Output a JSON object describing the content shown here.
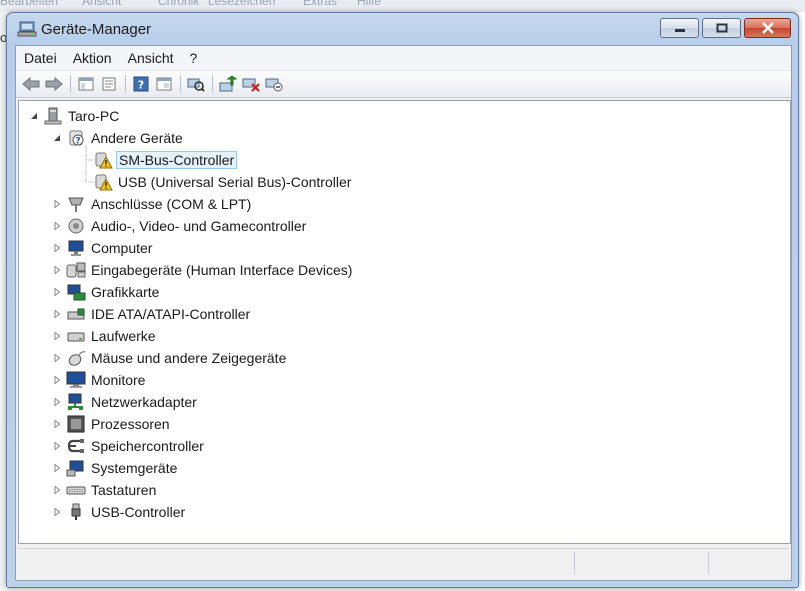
{
  "background": {
    "browser_menu": [
      "Bearbeiten",
      "Ansicht",
      "Chronik",
      "Lesezeichen",
      "Extras",
      "Hilfe"
    ],
    "left_fragment": "o"
  },
  "window": {
    "title": "Geräte-Manager",
    "controls": {
      "minimize": "minimize-icon",
      "maximize": "maximize-icon",
      "close": "close-icon"
    }
  },
  "menubar": [
    "Datei",
    "Aktion",
    "Ansicht",
    "?"
  ],
  "toolbar": [
    "back-arrow-icon",
    "forward-arrow-icon",
    "sep",
    "console-tree-icon",
    "properties-icon",
    "sep",
    "help-icon",
    "show-hide-icon",
    "sep",
    "scan-hardware-icon",
    "sep",
    "update-driver-icon",
    "uninstall-icon",
    "disable-icon"
  ],
  "tree": {
    "root": "Taro-PC",
    "other_devices": "Andere Geräte",
    "other_children": [
      "SM-Bus-Controller",
      "USB (Universal Serial Bus)-Controller"
    ],
    "categories": [
      "Anschlüsse (COM & LPT)",
      "Audio-, Video- und Gamecontroller",
      "Computer",
      "Eingabegeräte (Human Interface Devices)",
      "Grafikkarte",
      "IDE ATA/ATAPI-Controller",
      "Laufwerke",
      "Mäuse und andere Zeigegeräte",
      "Monitore",
      "Netzwerkadapter",
      "Prozessoren",
      "Speichercontroller",
      "Systemgeräte",
      "Tastaturen",
      "USB-Controller"
    ],
    "selected": "SM-Bus-Controller"
  },
  "colors": {
    "accent": "#99c9ef",
    "selection": "#e5f1fb",
    "title_bg": "#c6d8ee",
    "close": "#c5452b"
  }
}
